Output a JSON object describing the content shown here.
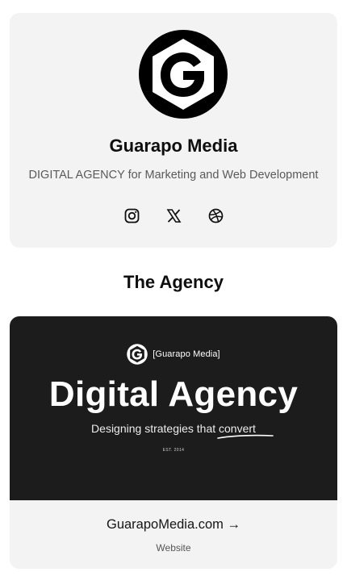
{
  "profile": {
    "name": "Guarapo Media",
    "description": "DIGITAL AGENCY for Marketing and Web Development",
    "logo_icon": "guarapo-g-logo",
    "socials": [
      {
        "name": "Instagram",
        "icon": "instagram-icon"
      },
      {
        "name": "X",
        "icon": "x-icon"
      },
      {
        "name": "Dribbble",
        "icon": "dribbble-icon"
      }
    ]
  },
  "section": {
    "heading": "The Agency"
  },
  "link_card": {
    "banner": {
      "brand": "[Guarapo Media]",
      "title": "Digital Agency",
      "tagline": "Designing strategies that convert",
      "est": "EST. 2014"
    },
    "title": "GuarapoMedia.com →",
    "subtitle": "Website"
  },
  "colors": {
    "card_bg": "#f3f3f3",
    "banner_bg": "#1c1c1c",
    "text_primary": "#0e0e0e",
    "text_secondary": "#5a5a5a"
  }
}
